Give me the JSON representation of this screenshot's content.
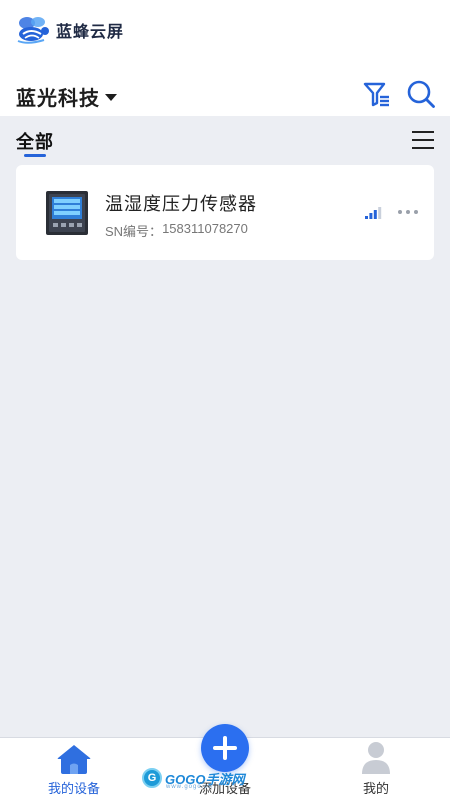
{
  "app": {
    "name": "蓝蜂云屏"
  },
  "header": {
    "company": "蓝光科技",
    "icons": [
      "filter-icon",
      "search-icon"
    ]
  },
  "tabs": {
    "active": "全部"
  },
  "devices": [
    {
      "name": "温湿度压力传感器",
      "sn_label": "SN编号：",
      "sn": "158311078270",
      "signal_bars": 4,
      "signal_active_bars": 3
    }
  ],
  "bottom_nav": {
    "home": "我的设备",
    "add": "添加设备",
    "mine": "我的"
  },
  "watermark": {
    "brand": "GOGO手游网",
    "sub": "www.gogo.cn"
  },
  "colors": {
    "accent": "#2563d9",
    "fab": "#2b6ff0",
    "background": "#eceef3",
    "muted_text": "#777777"
  }
}
